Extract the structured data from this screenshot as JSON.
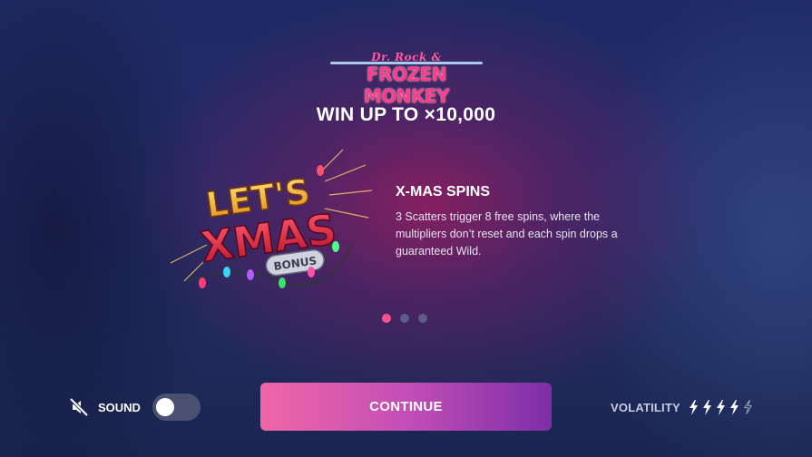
{
  "logo": {
    "line1": "Dr. Rock &",
    "line2": "FROZEN MONKEY"
  },
  "headline": "WIN UP TO ×10,000",
  "promo_art": {
    "line1": "LET'S",
    "line2": "XMAS",
    "line3": "BONUS"
  },
  "feature": {
    "title": "X-MAS SPINS",
    "description": "3 Scatters trigger 8 free spins, where the multipliers don’t reset and each spin drops a guaranteed Wild."
  },
  "carousel": {
    "total": 3,
    "active_index": 0
  },
  "sound": {
    "label": "SOUND",
    "enabled": false,
    "icon": "muted-speaker-icon"
  },
  "continue_label": "CONTINUE",
  "volatility": {
    "label": "VOLATILITY",
    "level": 4,
    "max": 5,
    "icon": "lightning-bolt-icon"
  },
  "colors": {
    "accent_pink": "#ff4f8e",
    "button_gradient_start": "#f066a6",
    "button_gradient_end": "#7c2ea8",
    "toggle_off": "#4a5170",
    "background": "#1f2a5c"
  }
}
